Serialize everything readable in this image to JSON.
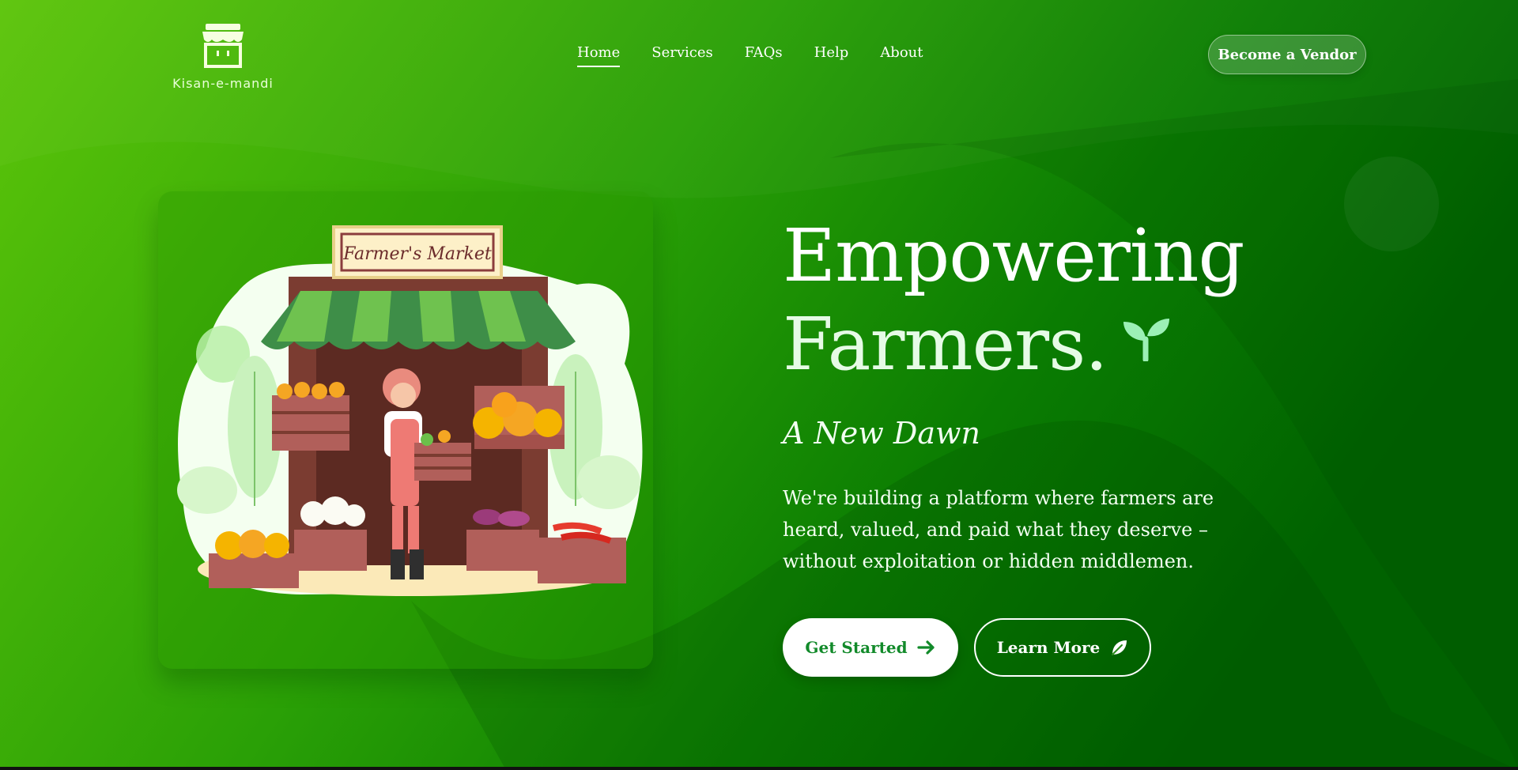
{
  "brand": {
    "name": "Kisan-e-mandi"
  },
  "nav": {
    "items": [
      {
        "label": "Home",
        "active": true
      },
      {
        "label": "Services"
      },
      {
        "label": "FAQs"
      },
      {
        "label": "Help"
      },
      {
        "label": "About"
      }
    ],
    "vendor_button": "Become a Vendor"
  },
  "hero": {
    "title_line1": "Empowering",
    "title_line2": "Farmers.",
    "tagline": "A New Dawn",
    "description": "We're building a platform where farmers are heard, valued, and paid what they deserve – without exploitation or hidden middlemen.",
    "primary_button": "Get Started",
    "secondary_button": "Learn More"
  },
  "illustration": {
    "sign_text": "Farmer's Market"
  },
  "icons": [
    "shop-logo-icon",
    "sprout-icon",
    "arrow-right-icon",
    "leaf-icon"
  ],
  "colors": {
    "gradient_start": "#5cc50a",
    "gradient_end": "#006400",
    "button_text_green": "#128a2a"
  }
}
